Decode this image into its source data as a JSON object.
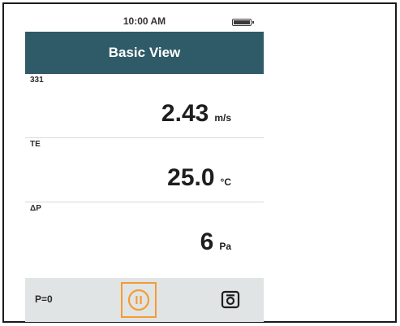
{
  "status_bar": {
    "time": "10:00 AM",
    "battery_icon": "battery-full-icon"
  },
  "header": {
    "title": "Basic View"
  },
  "readings": [
    {
      "label": "331",
      "value": "2.43",
      "unit": "m/s"
    },
    {
      "label": "TE",
      "value": "25.0",
      "unit": "°C"
    },
    {
      "label": "ΔP",
      "value": "6",
      "unit": "Pa"
    }
  ],
  "footer": {
    "pressure_label": "P=0",
    "pause_icon": "pause-circle-icon",
    "camera_icon": "camera-icon"
  },
  "colors": {
    "header_bg": "#2f5a67",
    "accent": "#f39c33",
    "footer_bg": "#e1e4e5"
  }
}
